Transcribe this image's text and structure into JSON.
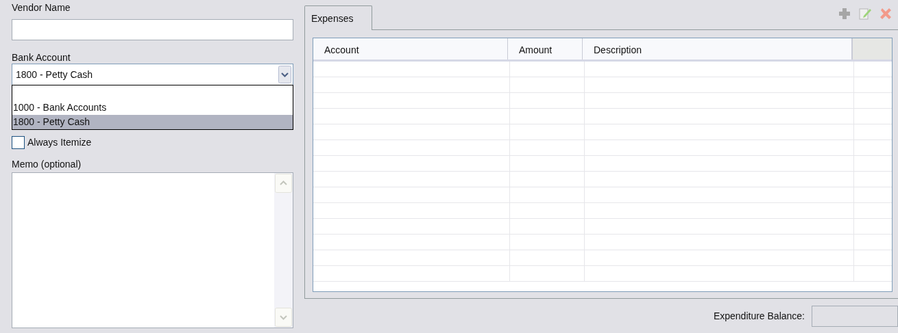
{
  "vendor_name": {
    "label": "Vendor Name"
  },
  "bank_account": {
    "label": "Bank Account",
    "value": "1800 - Petty Cash",
    "expanded": true,
    "options": [
      {
        "label": "1000 - Bank Accounts",
        "selected": false
      },
      {
        "label": "1800 - Petty Cash",
        "selected": true
      }
    ]
  },
  "always_itemize": {
    "label": "Always Itemize",
    "checked": false
  },
  "memo": {
    "label": "Memo (optional)"
  },
  "tabs": [
    {
      "label": "Expenses",
      "selected": true
    }
  ],
  "table": {
    "columns": [
      "Account",
      "Amount",
      "Description"
    ]
  },
  "expenditure_balance": {
    "label": "Expenditure Balance:"
  }
}
